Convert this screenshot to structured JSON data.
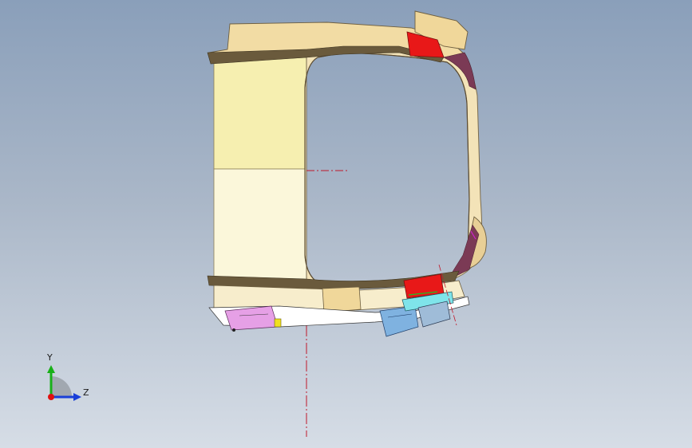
{
  "triad": {
    "y_label": "Y",
    "z_label": "Z",
    "colors": {
      "y": "#18b018",
      "z": "#1a3fd8",
      "origin": "#e01010"
    }
  },
  "model": {
    "colors": {
      "panel_light": "#fbf7da",
      "panel_yellow": "#f6efb0",
      "trim_tan": "#f2dca4",
      "trim_dark": "#7a6b4e",
      "highlight_red": "#e81818",
      "center_line": "#c0182a",
      "bracket_blue": "#7fb2e0",
      "bracket_pink": "#e6a0e6"
    }
  }
}
